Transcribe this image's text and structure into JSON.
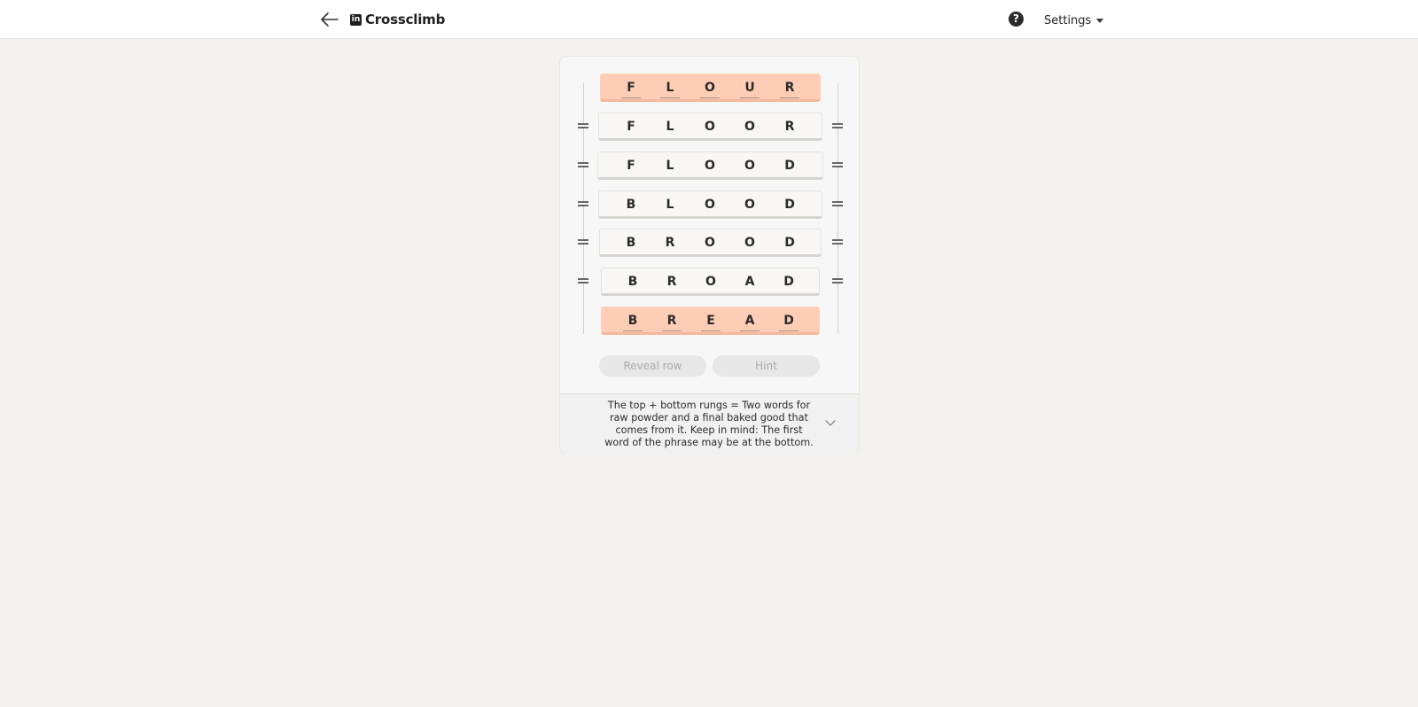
{
  "header": {
    "title": "Crossclimb",
    "logo_text": "in",
    "back_icon": "arrow-left-icon",
    "help_icon": "question-circle-icon",
    "help_symbol": "?",
    "settings_label": "Settings"
  },
  "colors": {
    "page_background": "#f4f2ee",
    "locked_rung": "#ffcdb5",
    "rung": "#f8f7f5",
    "disabled_button": "#e7e7e7"
  },
  "rungs": [
    {
      "letters": [
        "F",
        "L",
        "O",
        "U",
        "R"
      ],
      "locked": true
    },
    {
      "letters": [
        "F",
        "L",
        "O",
        "O",
        "R"
      ],
      "locked": false
    },
    {
      "letters": [
        "F",
        "L",
        "O",
        "O",
        "D"
      ],
      "locked": false
    },
    {
      "letters": [
        "B",
        "L",
        "O",
        "O",
        "D"
      ],
      "locked": false
    },
    {
      "letters": [
        "B",
        "R",
        "O",
        "O",
        "D"
      ],
      "locked": false
    },
    {
      "letters": [
        "B",
        "R",
        "O",
        "A",
        "D"
      ],
      "locked": false
    },
    {
      "letters": [
        "B",
        "R",
        "E",
        "A",
        "D"
      ],
      "locked": true
    }
  ],
  "buttons": {
    "reveal_row": "Reveal row",
    "hint": "Hint"
  },
  "clue": {
    "text": "The top + bottom rungs = Two words for raw powder and a final baked good that comes from it. Keep in mind: The first word of the phrase may be at the bottom."
  }
}
